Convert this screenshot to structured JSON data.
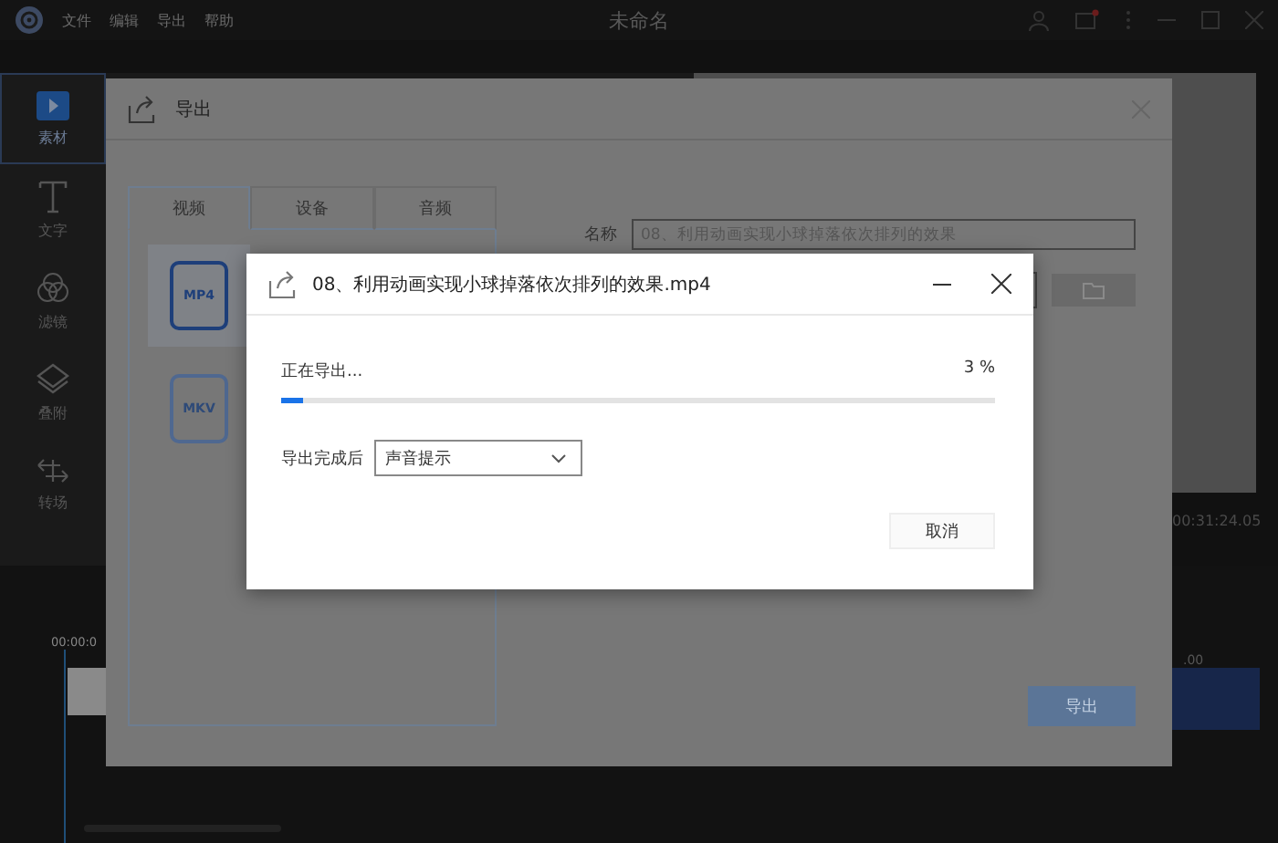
{
  "app": {
    "menu": [
      "文件",
      "编辑",
      "导出",
      "帮助"
    ],
    "title": "未命名"
  },
  "sidebar": {
    "items": [
      {
        "label": "素材",
        "kind": "media",
        "selected": true
      },
      {
        "label": "文字",
        "kind": "text",
        "selected": false
      },
      {
        "label": "滤镜",
        "kind": "filter",
        "selected": false
      },
      {
        "label": "叠附",
        "kind": "overlay",
        "selected": false
      },
      {
        "label": "转场",
        "kind": "transition",
        "selected": false
      }
    ]
  },
  "timeline": {
    "start_time": "00:00:0",
    "total_time": "00:31:24.05",
    "ruler_time": ".00"
  },
  "export_dialog": {
    "title": "导出",
    "tabs": [
      {
        "label": "视频",
        "selected": true
      },
      {
        "label": "设备",
        "selected": false
      },
      {
        "label": "音频",
        "selected": false
      }
    ],
    "formats": [
      {
        "label": "MP4",
        "selected": true
      },
      {
        "label": "MKV",
        "selected": false
      }
    ],
    "name_label": "名称",
    "name_value": "08、利用动画实现小球掉落依次排列的效果",
    "export_button": "导出"
  },
  "progress_dialog": {
    "title": "08、利用动画实现小球掉落依次排列的效果.mp4",
    "status": "正在导出...",
    "percent": "3 %",
    "level": 0.03,
    "after_label": "导出完成后",
    "after_option": "声音提示",
    "cancel_button": "取消"
  }
}
